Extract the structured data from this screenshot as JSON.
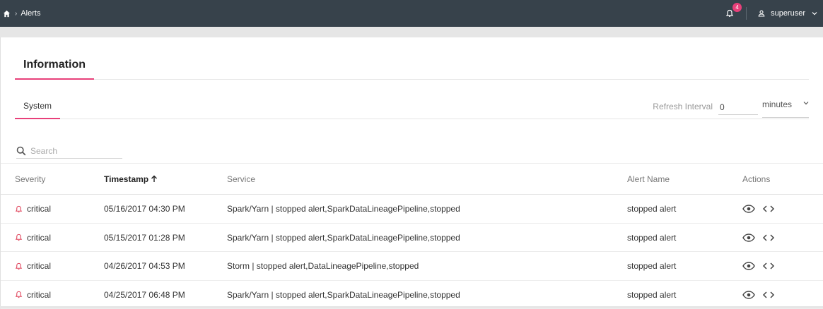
{
  "topbar": {
    "breadcrumb": {
      "home_icon": "home-icon",
      "separator": "›",
      "current": "Alerts"
    },
    "notifications": {
      "icon": "bell-icon",
      "count": "4"
    },
    "user": {
      "icon": "user-icon",
      "name": "superuser"
    }
  },
  "tabs": {
    "info": "Information",
    "system": "System"
  },
  "refresh": {
    "label": "Refresh Interval",
    "value": "0",
    "unit": "minutes"
  },
  "search": {
    "placeholder": "Search"
  },
  "table": {
    "headers": {
      "severity": "Severity",
      "timestamp": "Timestamp",
      "service": "Service",
      "alert_name": "Alert Name",
      "actions": "Actions"
    },
    "rows": [
      {
        "severity": "critical",
        "timestamp": "05/16/2017 04:30 PM",
        "service": "Spark/Yarn | stopped alert,SparkDataLineagePipeline,stopped",
        "alert_name": "stopped alert"
      },
      {
        "severity": "critical",
        "timestamp": "05/15/2017 01:28 PM",
        "service": "Spark/Yarn | stopped alert,SparkDataLineagePipeline,stopped",
        "alert_name": "stopped alert"
      },
      {
        "severity": "critical",
        "timestamp": "04/26/2017 04:53 PM",
        "service": "Storm | stopped alert,DataLineagePipeline,stopped",
        "alert_name": "stopped alert"
      },
      {
        "severity": "critical",
        "timestamp": "04/25/2017 06:48 PM",
        "service": "Spark/Yarn | stopped alert,SparkDataLineagePipeline,stopped",
        "alert_name": "stopped alert"
      }
    ]
  },
  "colors": {
    "topbar": "#37424b",
    "accent": "#e8407a",
    "critical": "#e0445b"
  }
}
